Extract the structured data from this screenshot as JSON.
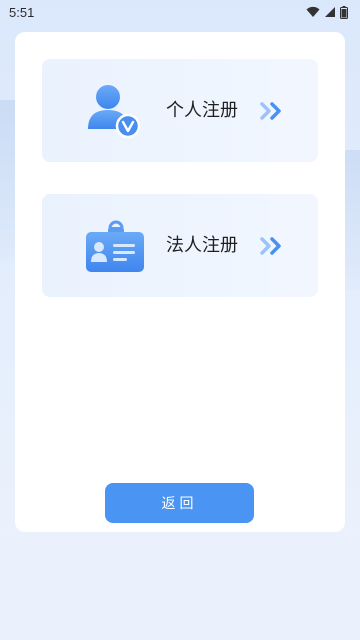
{
  "status_bar": {
    "time": "5:51",
    "icons": [
      "wifi-icon",
      "signal-icon",
      "battery-icon"
    ]
  },
  "registration": {
    "options": [
      {
        "label": "个人注册",
        "icon": "person-verified-icon"
      },
      {
        "label": "法人注册",
        "icon": "id-card-icon"
      }
    ],
    "arrow_icon": "double-chevron-right-icon"
  },
  "actions": {
    "back_label": "返回"
  },
  "colors": {
    "primary": "#4a94f3",
    "option_bg": "#eaf2fe",
    "icon_blue": "#5aa0f5"
  }
}
